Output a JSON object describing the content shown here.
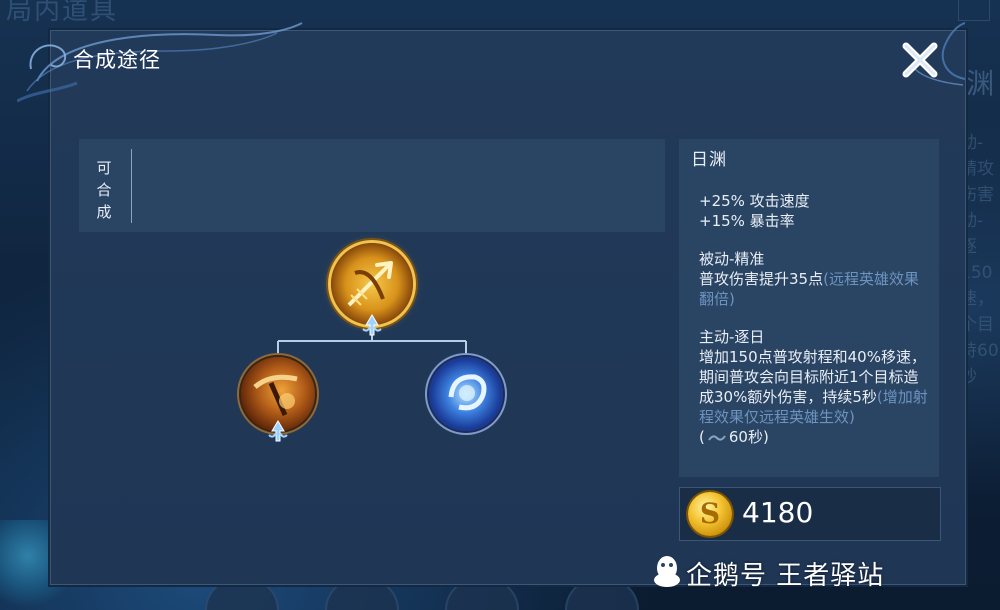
{
  "background": {
    "title": "局内道具",
    "right_title": "渊",
    "right_text": "动-精攻伤害动-逐150速，个目持60秒"
  },
  "dialog": {
    "title": "合成途径",
    "close_icon": "close-x-icon"
  },
  "craft": {
    "label": "可合成"
  },
  "tree": {
    "root": {
      "icon": "golden-bow-icon"
    },
    "children": [
      {
        "icon": "flame-crossbow-icon"
      },
      {
        "icon": "blue-orb-icon"
      }
    ]
  },
  "item": {
    "name": "日渊",
    "stats": [
      "+25% 攻击速度",
      "+15% 暴击率"
    ],
    "passive_title": "被动-精准",
    "passive_text": "普攻伤害提升35点",
    "passive_note": "(远程英雄效果翻倍)",
    "active_title": "主动-逐日",
    "active_text": "增加150点普攻射程和40%移速，期间普攻会向目标附近1个目标造成30%额外伤害，持续5秒",
    "active_note": "(增加射程效果仅远程英雄生效)",
    "cooldown_prefix": "(",
    "cooldown": "60秒)",
    "price": "4180",
    "currency_icon": "gold-coin-icon"
  },
  "watermark": {
    "text": "企鹅号 王者驿站",
    "icon": "penguin-icon"
  },
  "colors": {
    "panel_bg": "#223a59",
    "card_bg": "#2a4464",
    "highlight_text": "#6d93bf",
    "gold": "#f4c431"
  }
}
